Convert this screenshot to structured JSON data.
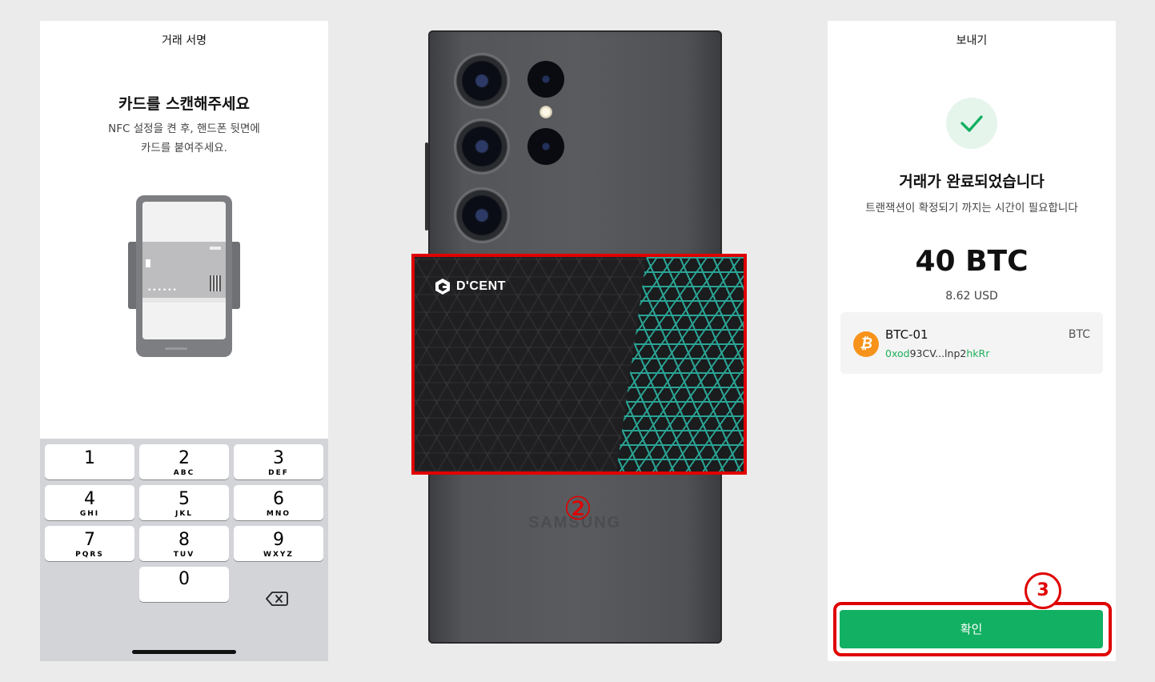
{
  "left_screen": {
    "title": "거래 서명",
    "heading": "카드를 스캔해주세요",
    "desc_line1": "NFC 설정을 켠 후, 핸드폰 뒷면에",
    "desc_line2": "카드를 붙여주세요.",
    "illustration": {
      "card_dots": "••••••"
    },
    "keypad": {
      "keys": [
        {
          "num": "1",
          "letters": ""
        },
        {
          "num": "2",
          "letters": "ABC"
        },
        {
          "num": "3",
          "letters": "DEF"
        },
        {
          "num": "4",
          "letters": "GHI"
        },
        {
          "num": "5",
          "letters": "JKL"
        },
        {
          "num": "6",
          "letters": "MNO"
        },
        {
          "num": "7",
          "letters": "PQRS"
        },
        {
          "num": "8",
          "letters": "TUV"
        },
        {
          "num": "9",
          "letters": "WXYZ"
        },
        {
          "num": "0",
          "letters": ""
        }
      ],
      "backspace_icon": "backspace-icon"
    }
  },
  "center": {
    "step_marker": "②",
    "card_brand": "D'CENT",
    "phone_brand": "SAMSUNG"
  },
  "right_screen": {
    "title": "보내기",
    "check_icon": "checkmark-icon",
    "heading": "거래가 완료되었습니다",
    "desc": "트랜잭션이 확정되기 까지는 시간이 필요합니다",
    "amount": "40 BTC",
    "fiat": "8.62 USD",
    "account": {
      "name": "BTC-01",
      "unit": "BTC",
      "address_prefix": "0xod",
      "address_middle": "93CV...lnp2",
      "address_suffix": "hkRr",
      "coin_icon": "bitcoin-icon"
    },
    "confirm_label": "확인",
    "step_marker": "3"
  },
  "colors": {
    "accent_green": "#12b062",
    "highlight_red": "#e00000",
    "bitcoin_orange": "#f7931a"
  }
}
